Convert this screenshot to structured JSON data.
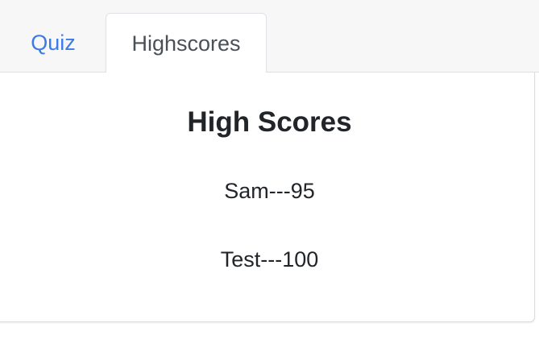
{
  "tabs": [
    {
      "label": "Quiz",
      "active": false
    },
    {
      "label": "Highscores",
      "active": true
    }
  ],
  "main": {
    "title": "High Scores",
    "scores": [
      {
        "text": "Sam---95"
      },
      {
        "text": "Test---100"
      }
    ]
  },
  "colors": {
    "link": "#3c7ae6",
    "active_tab_text": "#495057",
    "text": "#212529",
    "tabbar_bg": "#f7f7f7",
    "border": "#dee2e6"
  }
}
